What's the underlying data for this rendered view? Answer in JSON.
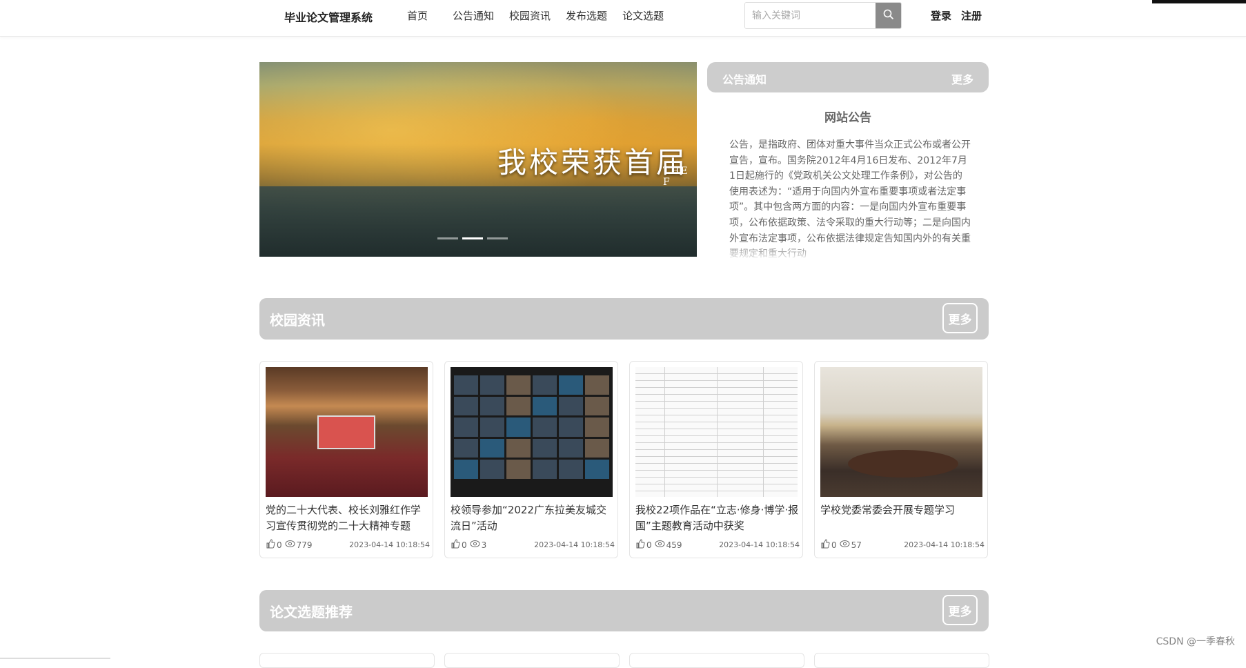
{
  "header": {
    "logo": "毕业论文管理系统",
    "nav": [
      "首页",
      "公告通知",
      "校园资讯",
      "发布选题",
      "论文选题"
    ],
    "search_placeholder": "输入关键词",
    "login": "登录",
    "register": "注册"
  },
  "banner": {
    "caption": "我校荣获首届",
    "sub": "THE F"
  },
  "notice": {
    "heading": "公告通知",
    "more": "更多",
    "title": "网站公告",
    "text": "公告，是指政府、团体对重大事件当众正式公布或者公开宣告，宣布。国务院2012年4月16日发布、2012年7月1日起施行的《党政机关公文处理工作条例》，对公告的使用表述为：“适用于向国内外宣布重要事项或者法定事项”。其中包含两方面的内容：一是向国内外宣布重要事项，公布依据政策、法令采取的重大行动等；二是向国内外宣布法定事项，公布依据法律规定告知国内外的有关重要规定和重大行动"
  },
  "news": {
    "heading": "校园资讯",
    "more": "更多",
    "cards": [
      {
        "title": "党的二十大代表、校长刘雅红作学习宣传贯彻党的二十大精神专题辅...",
        "likes": "0",
        "views": "779",
        "date": "2023-04-14 10:18:54"
      },
      {
        "title": "校领导参加“2022广东拉美友城交流日”活动",
        "likes": "0",
        "views": "3",
        "date": "2023-04-14 10:18:54"
      },
      {
        "title": "我校22项作品在“立志·修身·博学·报国”主题教育活动中获奖",
        "likes": "0",
        "views": "459",
        "date": "2023-04-14 10:18:54"
      },
      {
        "title": "学校党委常委会开展专题学习",
        "likes": "0",
        "views": "57",
        "date": "2023-04-14 10:18:54"
      }
    ]
  },
  "topics": {
    "heading": "论文选题推荐",
    "more": "更多"
  },
  "watermark": "CSDN @一季春秋"
}
